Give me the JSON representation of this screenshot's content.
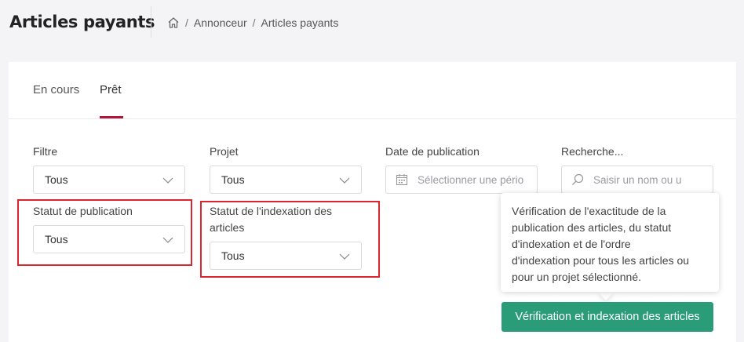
{
  "header": {
    "title": "Articles payants",
    "breadcrumb": [
      "Annonceur",
      "Articles payants"
    ],
    "separator": "/"
  },
  "tabs": [
    {
      "label": "En cours",
      "active": false
    },
    {
      "label": "Prêt",
      "active": true
    }
  ],
  "filters": {
    "filtre": {
      "label": "Filtre",
      "value": "Tous"
    },
    "projet": {
      "label": "Projet",
      "value": "Tous"
    },
    "date": {
      "label": "Date de publication",
      "placeholder": "Sélectionner une pério"
    },
    "recherche": {
      "label": "Recherche...",
      "placeholder": "Saisir un nom ou u"
    },
    "statut_publication": {
      "label": "Statut de publication",
      "value": "Tous"
    },
    "statut_indexation": {
      "label_line1": "Statut de l'indexation des",
      "label_line2": "articles",
      "value": "Tous"
    }
  },
  "tooltip": {
    "lines": [
      "Vérification de l'exactitude de la",
      "publication des articles, du statut",
      "d'indexation et de l'ordre",
      "d'indexation pour tous les articles ou",
      "pour un projet sélectionné."
    ]
  },
  "actions": {
    "verify_button": "Vérification et indexation des articles"
  },
  "colors": {
    "accent": "#b3143b",
    "primary_button": "#2a9d78",
    "highlight": "#d9262f"
  }
}
